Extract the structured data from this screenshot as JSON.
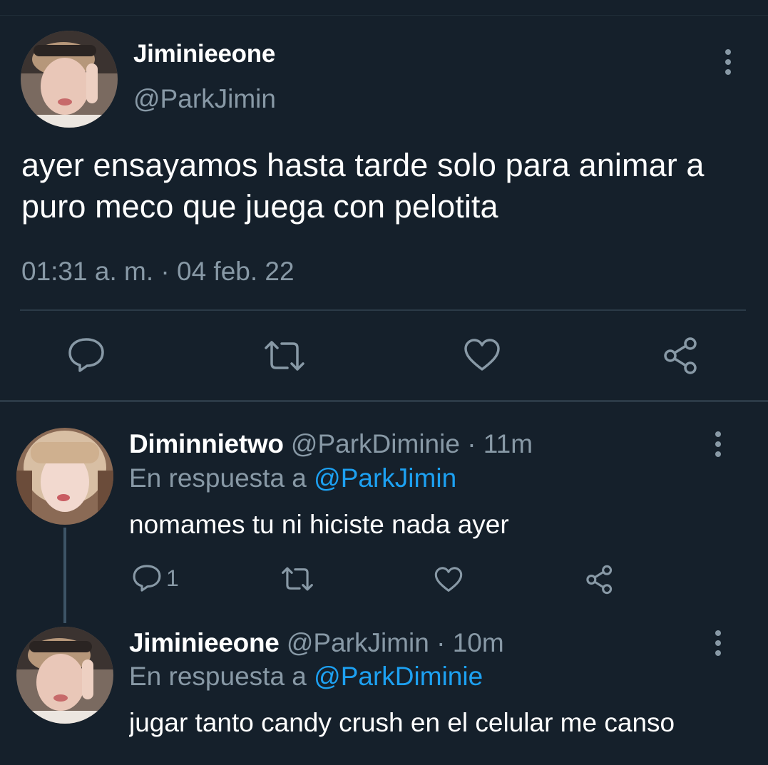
{
  "main_tweet": {
    "display_name": "Jiminieeone",
    "handle": "@ParkJimin",
    "text": "ayer ensayamos hasta tarde solo para animar a puro meco que juega con pelotita",
    "timestamp": "01:31 a. m. · 04 feb. 22",
    "actions": [
      "reply-icon",
      "retweet-icon",
      "like-icon",
      "share-icon"
    ]
  },
  "replies": [
    {
      "display_name": "Diminnietwo",
      "meta": "@ParkDiminie · 11m",
      "reply_prefix": "En respuesta a ",
      "reply_to": "@ParkJimin",
      "text": "nomames tu ni hiciste nada ayer",
      "reply_count": "1"
    },
    {
      "display_name": "Jiminieeone",
      "meta": "@ParkJimin · 10m",
      "reply_prefix": "En respuesta a ",
      "reply_to": "@ParkDiminie",
      "text": "jugar tanto candy crush en el celular me canso"
    }
  ],
  "colors": {
    "background": "#15202b",
    "secondary_text": "#8899a6",
    "link": "#1da1f2",
    "divider": "#2b3a47"
  }
}
